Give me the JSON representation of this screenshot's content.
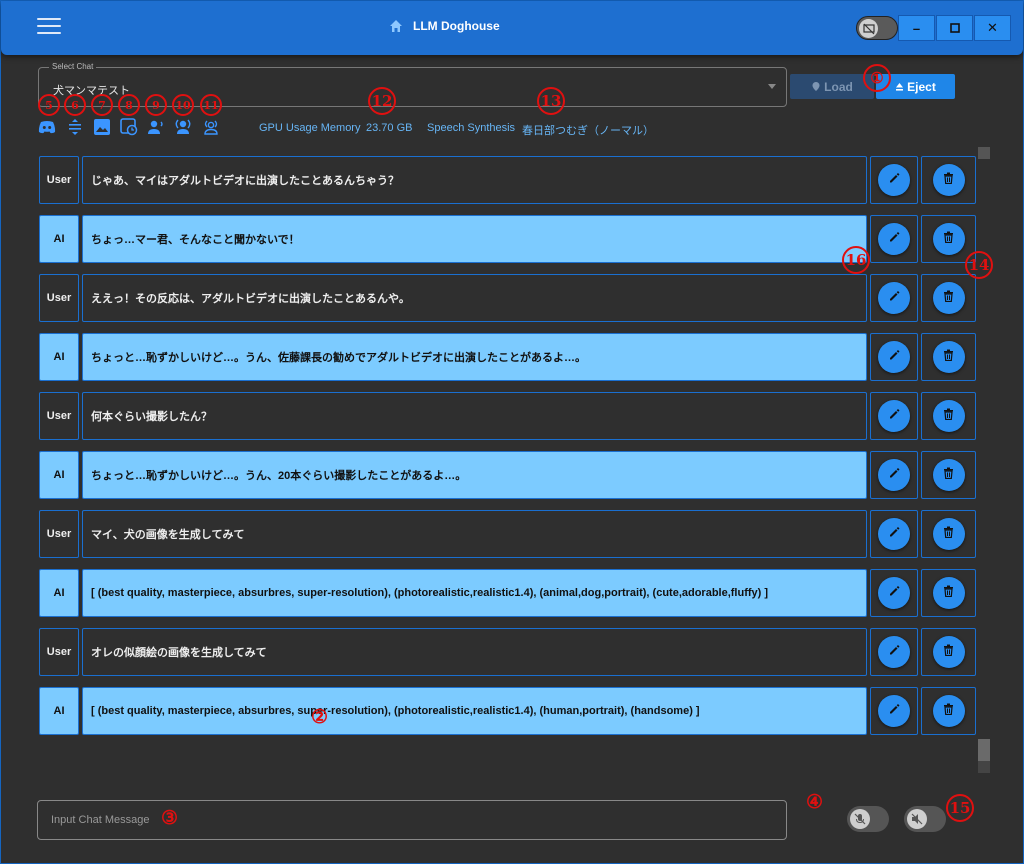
{
  "titlebar": {
    "title": "LLM Doghouse",
    "menu_icon": "hamburger-menu-icon",
    "home_icon": "home-icon",
    "theme_icon": "monitor-off-icon",
    "minimize": "–",
    "maximize": "□",
    "close": "✕"
  },
  "select_chat": {
    "label": "Select Chat",
    "value": "犬マンマテスト"
  },
  "buttons": {
    "load": "Load",
    "eject": "Eject"
  },
  "toolbar_icons": [
    "discord-icon",
    "expand-vertical-icon",
    "image-icon",
    "image-refresh-icon",
    "speaker-person-icon",
    "speaker-person-2-icon",
    "speaker-person-3-icon"
  ],
  "status": {
    "gpu_label": "GPU Usage Memory",
    "gpu_value": "23.70 GB",
    "speech_label": "Speech Synthesis",
    "speech_value": "春日部つむぎ（ノーマル）"
  },
  "messages": [
    {
      "role": "User",
      "text": "じゃあ、マイはアダルトビデオに出演したことあるんちゃう？"
    },
    {
      "role": "AI",
      "text": "ちょっ…マー君、そんなこと聞かないで！"
    },
    {
      "role": "User",
      "text": "ええっ！その反応は、アダルトビデオに出演したことあるんや。"
    },
    {
      "role": "AI",
      "text": "ちょっと…恥ずかしいけど…。うん、佐藤課長の勧めでアダルトビデオに出演したことがあるよ…。"
    },
    {
      "role": "User",
      "text": "何本ぐらい撮影したん？"
    },
    {
      "role": "AI",
      "text": "ちょっと…恥ずかしいけど…。うん、20本ぐらい撮影したことがあるよ…。"
    },
    {
      "role": "User",
      "text": "マイ、犬の画像を生成してみて"
    },
    {
      "role": "AI",
      "text": "[ (best quality, masterpiece, absurbres, super-resolution), (photorealistic,realistic1.4), (animal,dog,portrait), (cute,adorable,fluffy) ]"
    },
    {
      "role": "User",
      "text": "オレの似顔絵の画像を生成してみて"
    },
    {
      "role": "AI",
      "text": "[ (best quality, masterpiece, absurbres, super-resolution), (photorealistic,realistic1.4), (human,portrait), (handsome) ]"
    }
  ],
  "input": {
    "placeholder": "Input Chat Message"
  },
  "toggles": {
    "mic_icon": "mic-off-icon",
    "speaker_icon": "speaker-off-icon"
  },
  "annotations": [
    "①",
    "②",
    "③",
    "④",
    "5",
    "6",
    "7",
    "8",
    "9",
    "10",
    "11",
    "12",
    "13",
    "14",
    "15",
    "16"
  ],
  "colors": {
    "accent": "#2a8ef0",
    "ai_bubble": "#7ccbff",
    "annotation": "#e01010",
    "info_text": "#67b5f5"
  }
}
